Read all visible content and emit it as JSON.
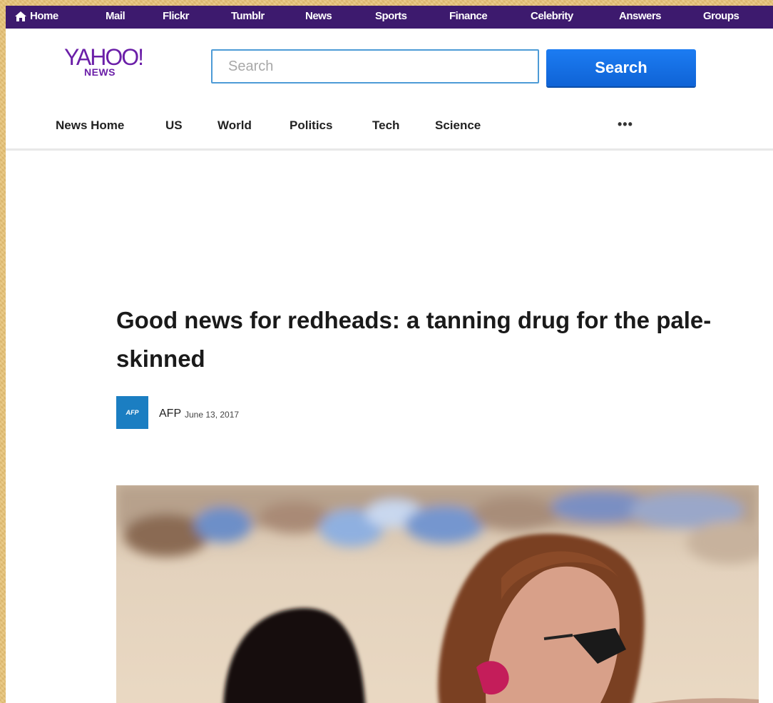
{
  "topnav": {
    "items": [
      {
        "label": "Home"
      },
      {
        "label": "Mail"
      },
      {
        "label": "Flickr"
      },
      {
        "label": "Tumblr"
      },
      {
        "label": "News"
      },
      {
        "label": "Sports"
      },
      {
        "label": "Finance"
      },
      {
        "label": "Celebrity"
      },
      {
        "label": "Answers"
      },
      {
        "label": "Groups"
      }
    ]
  },
  "header": {
    "logo_text": "YAHOO!",
    "logo_sub": "NEWS",
    "search_placeholder": "Search",
    "search_button": "Search"
  },
  "nav": {
    "items": [
      {
        "label": "News Home"
      },
      {
        "label": "US"
      },
      {
        "label": "World"
      },
      {
        "label": "Politics"
      },
      {
        "label": "Tech"
      },
      {
        "label": "Science"
      }
    ],
    "more": "•••"
  },
  "article": {
    "headline": "Good news for redheads: a tanning drug for the pale-skinned",
    "source": "AFP",
    "source_logo_text": "AFP",
    "date": "June 13, 2017"
  },
  "colors": {
    "topbar": "#3d1a6e",
    "brand": "#6b1fa8",
    "search_button": "#1a73e8",
    "afp": "#1b7ec2"
  }
}
